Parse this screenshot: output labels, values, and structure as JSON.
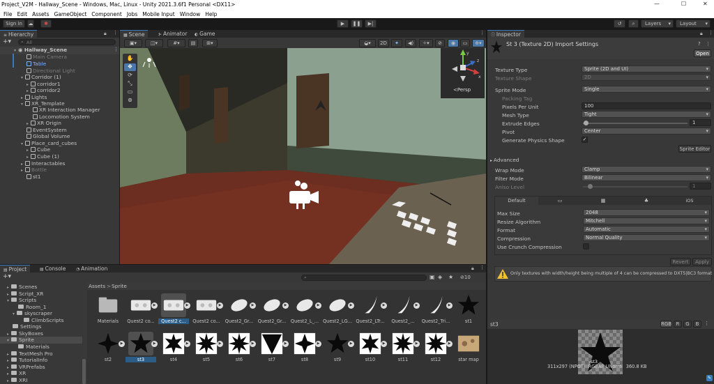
{
  "window": {
    "title": "Project_V2M - Hallway_Scene - Windows, Mac, Linux - Unity 2021.3.6f1 Personal <DX11>",
    "minimize": "—",
    "maximize": "☐",
    "close": "✕"
  },
  "menu": [
    "File",
    "Edit",
    "Assets",
    "GameObject",
    "Component",
    "Jobs",
    "Mobile Input",
    "Window",
    "Help"
  ],
  "toolbar": {
    "signin": "Sign in",
    "layers": "Layers",
    "layout": "Layout"
  },
  "hierarchy": {
    "tab": "Hierarchy",
    "search_placeholder": "All",
    "scene": "Hallway_Scene",
    "items": [
      "Main Camera",
      "Table",
      "Directional Light",
      "Corridor (1)",
      "corridor1",
      "corridor2",
      "Lights",
      "XR_Template",
      "XR Interaction Manager",
      "Locomotion System",
      "XR Origin",
      "EventSystem",
      "Global Volume",
      "Place_card_cubes",
      "Cube",
      "Cube (1)",
      "Interactables",
      "Bottle",
      "st1"
    ]
  },
  "scene_tabs": [
    "Scene",
    "Animator",
    "Game"
  ],
  "scene": {
    "mode_2d": "2D",
    "persp": "<Persp",
    "gizmo_axes": [
      "y",
      "x",
      "z"
    ]
  },
  "inspector": {
    "tab": "Inspector",
    "title": "St 3 (Texture 2D) Import Settings",
    "open": "Open",
    "texture_type_label": "Texture Type",
    "texture_type": "Sprite (2D and UI)",
    "texture_shape_label": "Texture Shape",
    "texture_shape": "2D",
    "sprite_mode_label": "Sprite Mode",
    "sprite_mode": "Single",
    "packing_tag": "Packing Tag",
    "ppu_label": "Pixels Per Unit",
    "ppu": "100",
    "mesh_type_label": "Mesh Type",
    "mesh_type": "Tight",
    "extrude_label": "Extrude Edges",
    "extrude": "1",
    "pivot_label": "Pivot",
    "pivot": "Center",
    "physics_label": "Generate Physics Shape",
    "sprite_editor": "Sprite Editor",
    "advanced": "Advanced",
    "wrap_label": "Wrap Mode",
    "wrap": "Clamp",
    "filter_label": "Filter Mode",
    "filter": "Bilinear",
    "aniso_label": "Aniso Level",
    "aniso": "1",
    "platform_default": "Default",
    "platform_ios": "iOS",
    "max_size_label": "Max Size",
    "max_size": "2048",
    "resize_label": "Resize Algorithm",
    "resize": "Mitchell",
    "format_label": "Format",
    "format": "Automatic",
    "compression_label": "Compression",
    "compression": "Normal Quality",
    "crunch_label": "Use Crunch Compression",
    "revert": "Revert",
    "apply": "Apply",
    "warning": "Only textures with width/height being multiple of 4 can be compressed to DXT5|BC3 format"
  },
  "preview": {
    "name": "st3",
    "channels": [
      "RGB",
      "R",
      "G",
      "B"
    ],
    "sprite_label": "st3",
    "info": "311x297 (NPOT)  RGBA8 UNorm   360.8 KB"
  },
  "bottom_tabs": [
    "Project",
    "Console",
    "Animation"
  ],
  "project": {
    "breadcrumb_root": "Assets",
    "breadcrumb_sep": ">",
    "breadcrumb_leaf": "Sprite",
    "count": "10",
    "folders": [
      "Scenes",
      "Script_XR",
      "Scripts",
      "Room_1",
      "skyscraper",
      "ClimbScripts",
      "Settings",
      "SkyBoxes",
      "Sprite",
      "Materials",
      "TextMesh Pro",
      "TutorialInfo",
      "VRPrefabs",
      "XR",
      "XRI"
    ],
    "row1": [
      "Materials",
      "Quest2 co...",
      "Quest2 c...",
      "Quest2 co...",
      "Quest2_Gr...",
      "Quest2_Gr...",
      "Quest2_L_...",
      "Quest2_LG...",
      "Quest2_LTr...",
      "Quest2_...",
      "Quest2_Tri...",
      "st1"
    ],
    "row2": [
      "st2",
      "st3",
      "st4",
      "st5",
      "st6",
      "st7",
      "st8",
      "st9",
      "st10",
      "st11",
      "st12",
      "star map"
    ]
  },
  "colors": {
    "accent": "#3a79bb",
    "selection": "#2c5d87",
    "panel": "#383838",
    "header": "#282828"
  }
}
